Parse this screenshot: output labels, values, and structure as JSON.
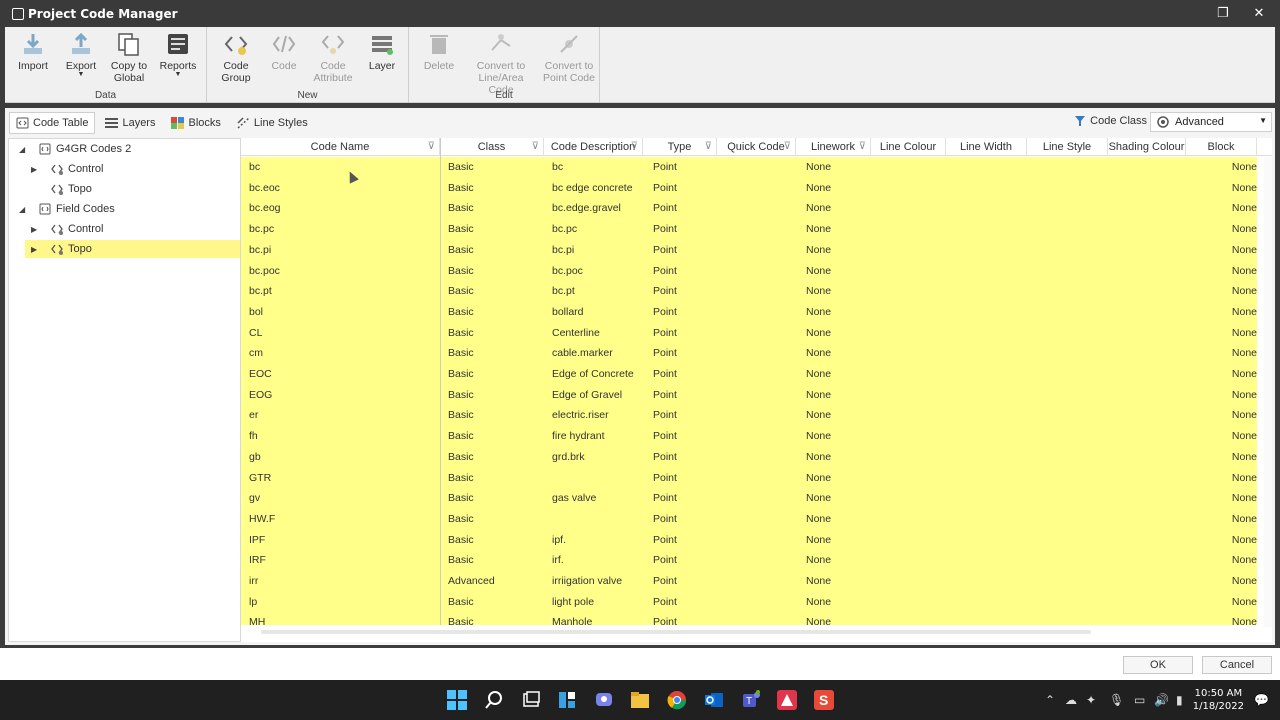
{
  "window": {
    "title": "Project Code Manager"
  },
  "ribbon": {
    "groups": [
      {
        "label": "Data",
        "buttons": [
          {
            "label": "Import",
            "icon": "import-icon",
            "disabled": false
          },
          {
            "label": "Export",
            "icon": "export-icon",
            "disabled": false,
            "dropdown": true
          },
          {
            "label": "Copy to Global",
            "icon": "copy-icon",
            "disabled": false
          },
          {
            "label": "Reports",
            "icon": "reports-icon",
            "disabled": false,
            "dropdown": true
          }
        ]
      },
      {
        "label": "New",
        "buttons": [
          {
            "label": "Code Group",
            "icon": "code-group-icon",
            "disabled": false
          },
          {
            "label": "Code",
            "icon": "code-icon",
            "disabled": true
          },
          {
            "label": "Code Attribute",
            "icon": "code-attribute-icon",
            "disabled": true
          },
          {
            "label": "Layer",
            "icon": "layer-icon",
            "disabled": false
          }
        ]
      },
      {
        "label": "Edit",
        "buttons": [
          {
            "label": "Delete",
            "icon": "delete-icon",
            "disabled": true
          },
          {
            "label": "Convert to Line/Area Code",
            "icon": "convert-line-icon",
            "disabled": true
          },
          {
            "label": "Convert to Point Code",
            "icon": "convert-point-icon",
            "disabled": true
          }
        ]
      }
    ]
  },
  "tabs": [
    {
      "label": "Code Table",
      "icon": "code-table-icon",
      "active": true
    },
    {
      "label": "Layers",
      "icon": "layers-icon",
      "active": false
    },
    {
      "label": "Blocks",
      "icon": "blocks-icon",
      "active": false
    },
    {
      "label": "Line Styles",
      "icon": "line-styles-icon",
      "active": false
    }
  ],
  "code_class": {
    "label": "Code Class",
    "selected": "Advanced"
  },
  "tree": [
    {
      "label": "G4GR Codes 2",
      "level": 0,
      "expanded": true
    },
    {
      "label": "Control",
      "level": 1,
      "expanded": false,
      "has_children": true
    },
    {
      "label": "Topo",
      "level": 1,
      "has_children": false
    },
    {
      "label": "Field Codes",
      "level": 0,
      "expanded": true
    },
    {
      "label": "Control",
      "level": 1,
      "expanded": false,
      "has_children": true
    },
    {
      "label": "Topo",
      "level": 1,
      "expanded": false,
      "has_children": true,
      "selected": true
    }
  ],
  "table": {
    "columns": [
      "Code Name",
      "Class",
      "Code Description",
      "Type",
      "Quick Code",
      "Linework",
      "Line Colour",
      "Line Width",
      "Line Style",
      "Shading Colour",
      "Block"
    ],
    "rows": [
      [
        "bc",
        "Basic",
        "bc",
        "Point",
        "",
        "None",
        "",
        "",
        "",
        "",
        "None"
      ],
      [
        "bc.eoc",
        "Basic",
        "bc edge concrete",
        "Point",
        "",
        "None",
        "",
        "",
        "",
        "",
        "None"
      ],
      [
        "bc.eog",
        "Basic",
        "bc.edge.gravel",
        "Point",
        "",
        "None",
        "",
        "",
        "",
        "",
        "None"
      ],
      [
        "bc.pc",
        "Basic",
        "bc.pc",
        "Point",
        "",
        "None",
        "",
        "",
        "",
        "",
        "None"
      ],
      [
        "bc.pi",
        "Basic",
        "bc.pi",
        "Point",
        "",
        "None",
        "",
        "",
        "",
        "",
        "None"
      ],
      [
        "bc.poc",
        "Basic",
        "bc.poc",
        "Point",
        "",
        "None",
        "",
        "",
        "",
        "",
        "None"
      ],
      [
        "bc.pt",
        "Basic",
        "bc.pt",
        "Point",
        "",
        "None",
        "",
        "",
        "",
        "",
        "None"
      ],
      [
        "bol",
        "Basic",
        "bollard",
        "Point",
        "",
        "None",
        "",
        "",
        "",
        "",
        "None"
      ],
      [
        "CL",
        "Basic",
        "Centerline",
        "Point",
        "",
        "None",
        "",
        "",
        "",
        "",
        "None"
      ],
      [
        "cm",
        "Basic",
        "cable.marker",
        "Point",
        "",
        "None",
        "",
        "",
        "",
        "",
        "None"
      ],
      [
        "EOC",
        "Basic",
        "Edge of Concrete",
        "Point",
        "",
        "None",
        "",
        "",
        "",
        "",
        "None"
      ],
      [
        "EOG",
        "Basic",
        "Edge of Gravel",
        "Point",
        "",
        "None",
        "",
        "",
        "",
        "",
        "None"
      ],
      [
        "er",
        "Basic",
        "electric.riser",
        "Point",
        "",
        "None",
        "",
        "",
        "",
        "",
        "None"
      ],
      [
        "fh",
        "Basic",
        "fire hydrant",
        "Point",
        "",
        "None",
        "",
        "",
        "",
        "",
        "None"
      ],
      [
        "gb",
        "Basic",
        "grd.brk",
        "Point",
        "",
        "None",
        "",
        "",
        "",
        "",
        "None"
      ],
      [
        "GTR",
        "Basic",
        "",
        "Point",
        "",
        "None",
        "",
        "",
        "",
        "",
        "None"
      ],
      [
        "gv",
        "Basic",
        "gas valve",
        "Point",
        "",
        "None",
        "",
        "",
        "",
        "",
        "None"
      ],
      [
        "HW.F",
        "Basic",
        "",
        "Point",
        "",
        "None",
        "",
        "",
        "",
        "",
        "None"
      ],
      [
        "IPF",
        "Basic",
        "ipf.",
        "Point",
        "",
        "None",
        "",
        "",
        "",
        "",
        "None"
      ],
      [
        "IRF",
        "Basic",
        "irf.",
        "Point",
        "",
        "None",
        "",
        "",
        "",
        "",
        "None"
      ],
      [
        "irr",
        "Advanced",
        "irriigation valve",
        "Point",
        "",
        "None",
        "",
        "",
        "",
        "",
        "None"
      ],
      [
        "lp",
        "Basic",
        "light pole",
        "Point",
        "",
        "None",
        "",
        "",
        "",
        "",
        "None"
      ],
      [
        "MH",
        "Basic",
        "Manhole",
        "Point",
        "",
        "None",
        "",
        "",
        "",
        "",
        "None"
      ]
    ]
  },
  "footer": {
    "ok": "OK",
    "cancel": "Cancel"
  },
  "taskbar": {
    "time": "10:50 AM",
    "date": "1/18/2022",
    "apps": [
      "windows-start-icon",
      "search-icon",
      "task-view-icon",
      "widgets-icon",
      "chat-icon",
      "file-explorer-icon",
      "chrome-icon",
      "outlook-icon",
      "teams-icon",
      "autodesk-icon",
      "app-s-icon"
    ]
  },
  "colors": {
    "row_highlight": "#ffff8a",
    "selected_node": "#fff78a",
    "titlebar": "#3a3a3a",
    "taskbar": "#202020"
  }
}
